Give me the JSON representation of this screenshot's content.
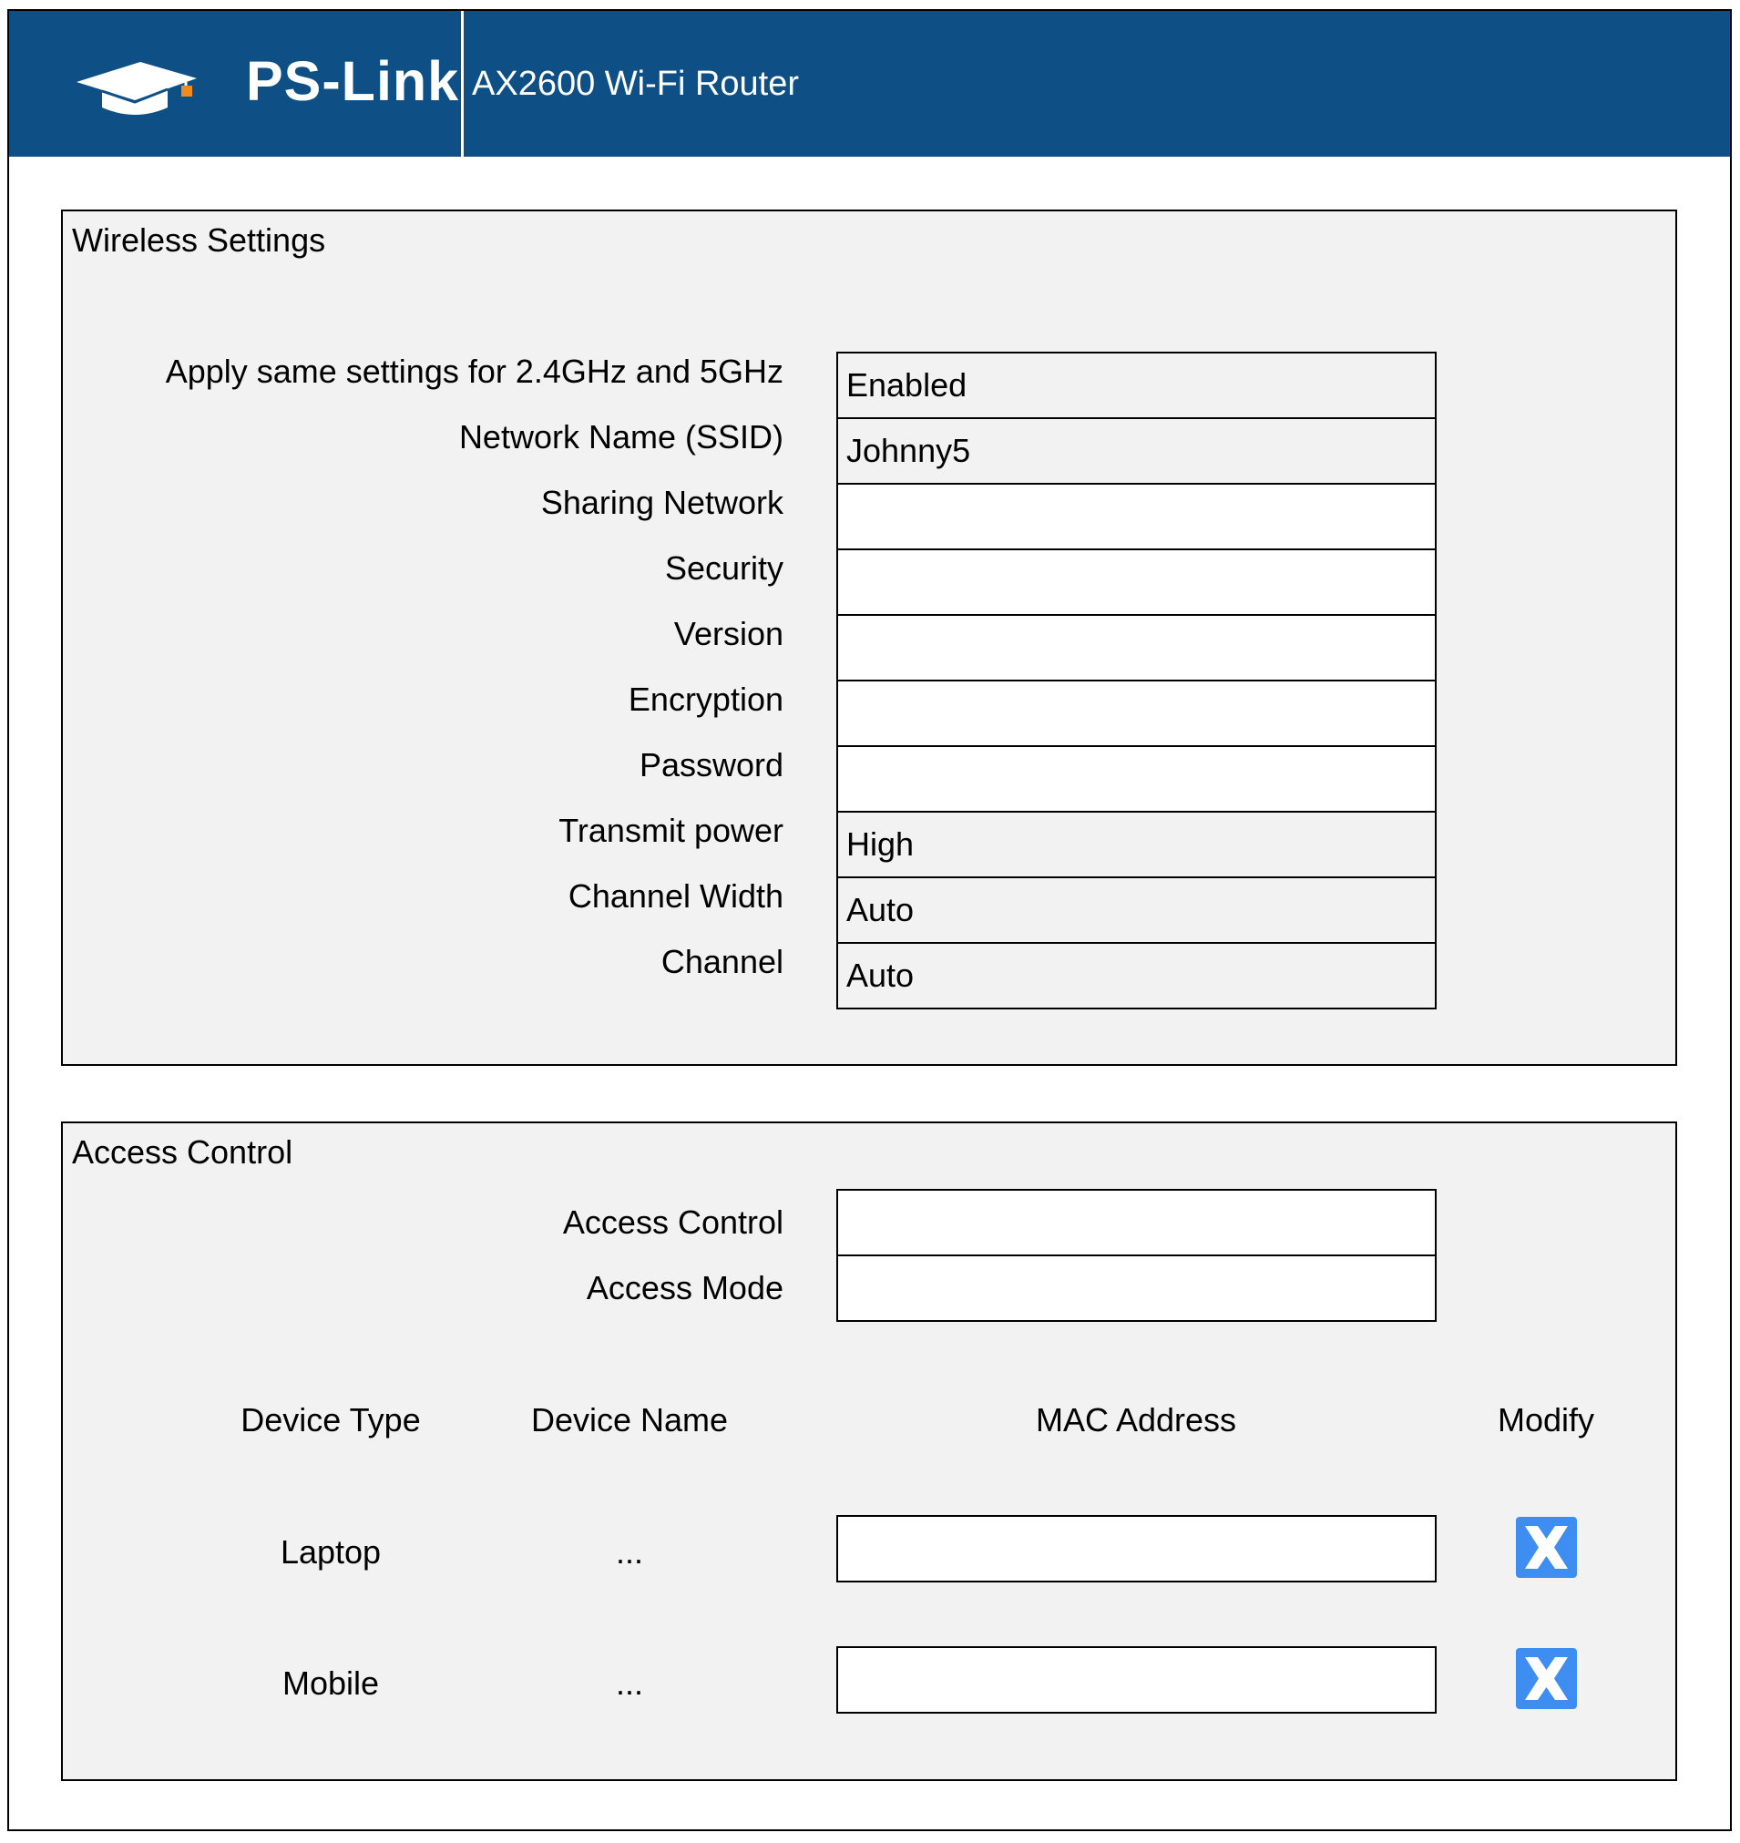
{
  "header": {
    "brand": "PS-Link",
    "subtitle": "AX2600 Wi-Fi Router",
    "logo_icon": "graduation-cap-icon",
    "background_color": "#0e5086"
  },
  "wireless": {
    "title": "Wireless Settings",
    "rows": [
      {
        "label": "Apply same settings for 2.4GHz and 5GHz",
        "value": "Enabled"
      },
      {
        "label": "Network Name (SSID)",
        "value": "Johnny5"
      },
      {
        "label": "Sharing Network",
        "value": ""
      },
      {
        "label": "Security",
        "value": ""
      },
      {
        "label": "Version",
        "value": ""
      },
      {
        "label": "Encryption",
        "value": ""
      },
      {
        "label": "Password",
        "value": ""
      },
      {
        "label": "Transmit power",
        "value": "High"
      },
      {
        "label": "Channel Width",
        "value": "Auto"
      },
      {
        "label": "Channel",
        "value": "Auto"
      }
    ]
  },
  "access": {
    "title": "Access Control",
    "rows": [
      {
        "label": "Access Control",
        "value": ""
      },
      {
        "label": "Access Mode",
        "value": ""
      }
    ],
    "table": {
      "headers": [
        "Device Type",
        "Device Name",
        "MAC Address",
        "Modify"
      ],
      "rows": [
        {
          "device_type": "Laptop",
          "device_name": "...",
          "mac": "",
          "modify_icon": "delete-x-icon"
        },
        {
          "device_type": "Mobile",
          "device_name": "...",
          "mac": "",
          "modify_icon": "delete-x-icon"
        }
      ]
    },
    "delete_button_color": "#3d8ef0"
  }
}
